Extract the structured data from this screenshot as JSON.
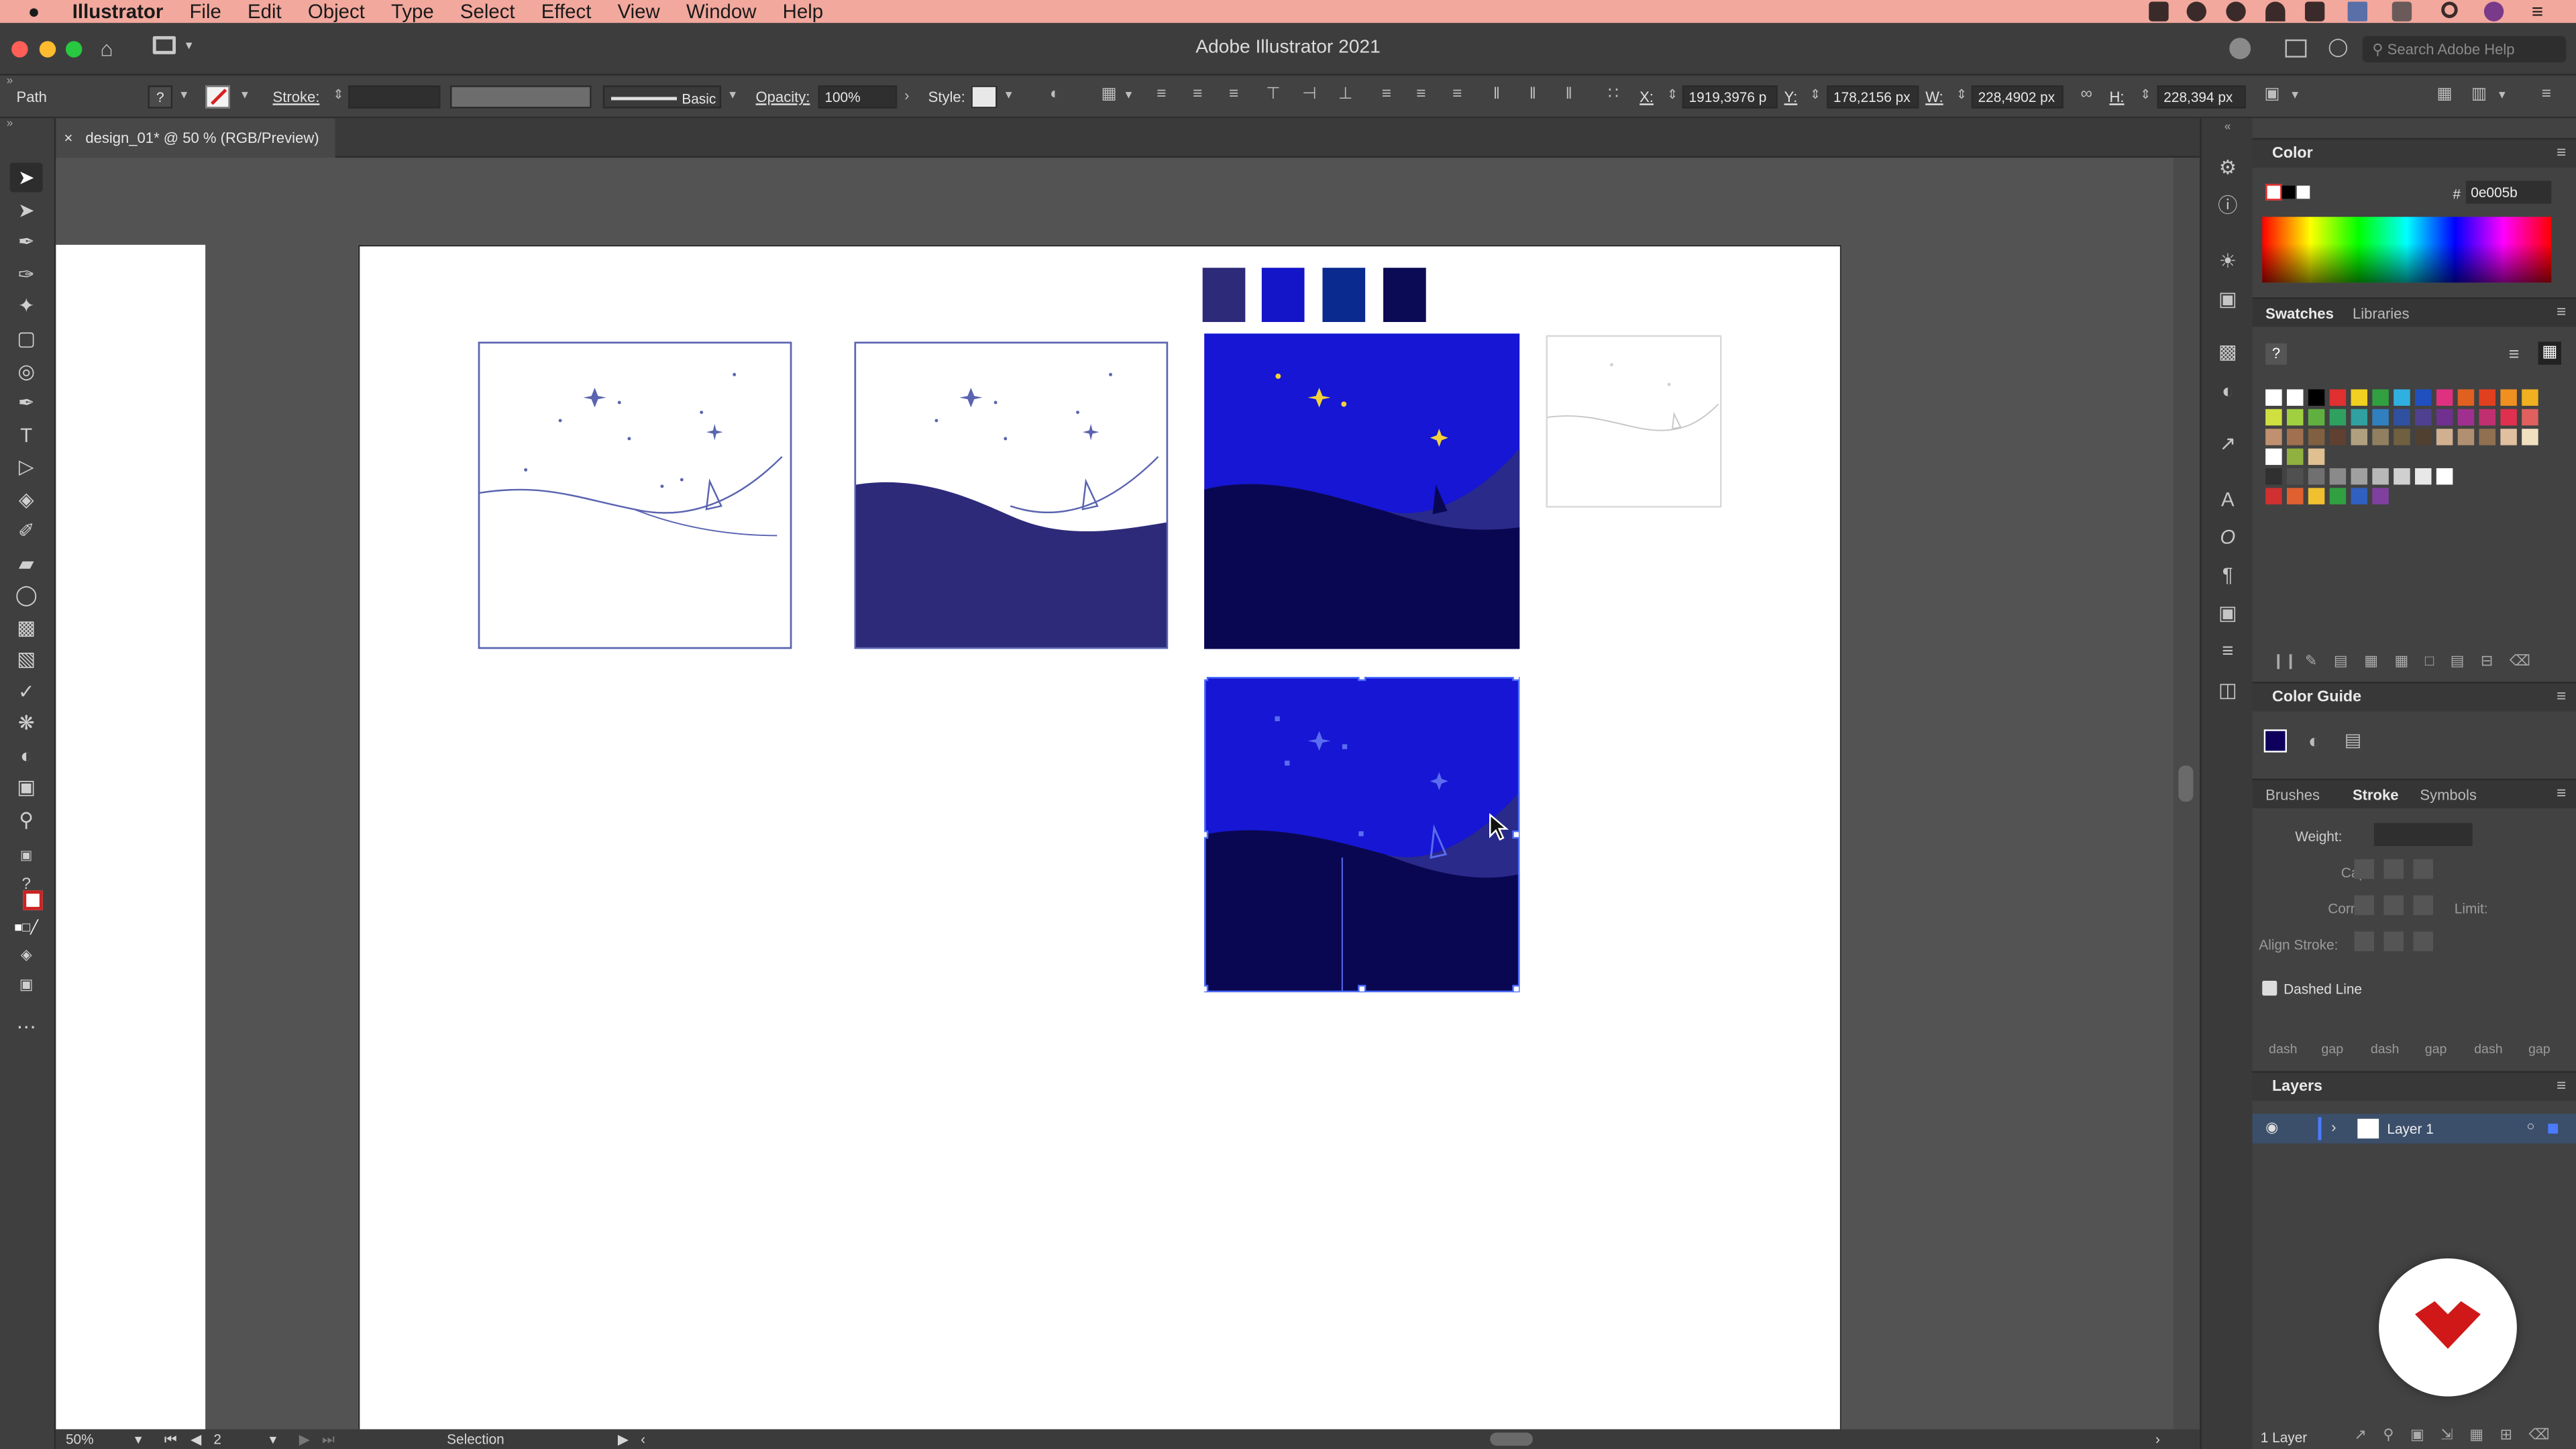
{
  "menubar": {
    "app_name": "Illustrator",
    "items": [
      "File",
      "Edit",
      "Object",
      "Type",
      "Select",
      "Effect",
      "View",
      "Window",
      "Help"
    ]
  },
  "titlebar": {
    "title": "Adobe Illustrator 2021",
    "search_placeholder": "Search Adobe Help"
  },
  "controlbar": {
    "selection_type": "Path",
    "stroke_label": "Stroke:",
    "brush_label": "Basic",
    "opacity_label": "Opacity:",
    "opacity_value": "100%",
    "style_label": "Style:",
    "x_label": "X:",
    "x_value": "1919,3976 p",
    "y_label": "Y:",
    "y_value": "178,2156 px",
    "w_label": "W:",
    "w_value": "228,4902 px",
    "h_label": "H:",
    "h_value": "228,394 px"
  },
  "document": {
    "tab_title": "design_01* @ 50 % (RGB/Preview)"
  },
  "palette_swatches": [
    "#2e2a7a",
    "#1414c8",
    "#0a2a8f",
    "#0a0a55"
  ],
  "color_panel": {
    "title": "Color",
    "hex_value": "0e005b"
  },
  "swatches_panel": {
    "tab_swatches": "Swatches",
    "tab_libraries": "Libraries"
  },
  "color_guide": {
    "title": "Color Guide"
  },
  "stroke_panel": {
    "tab_brushes": "Brushes",
    "tab_stroke": "Stroke",
    "tab_symbols": "Symbols",
    "weight_label": "Weight:",
    "cap_label": "Cap:",
    "corner_label": "Corner:",
    "limit_label": "Limit:",
    "align_label": "Align Stroke:",
    "dashed_line_label": "Dashed Line",
    "dash_gap_labels": [
      "dash",
      "gap",
      "dash",
      "gap",
      "dash",
      "gap"
    ]
  },
  "layers_panel": {
    "title": "Layers",
    "layer_name": "Layer 1",
    "footer_count": "1 Layer"
  },
  "statusbar": {
    "zoom": "50%",
    "artboard_number": "2",
    "tool_name": "Selection"
  }
}
